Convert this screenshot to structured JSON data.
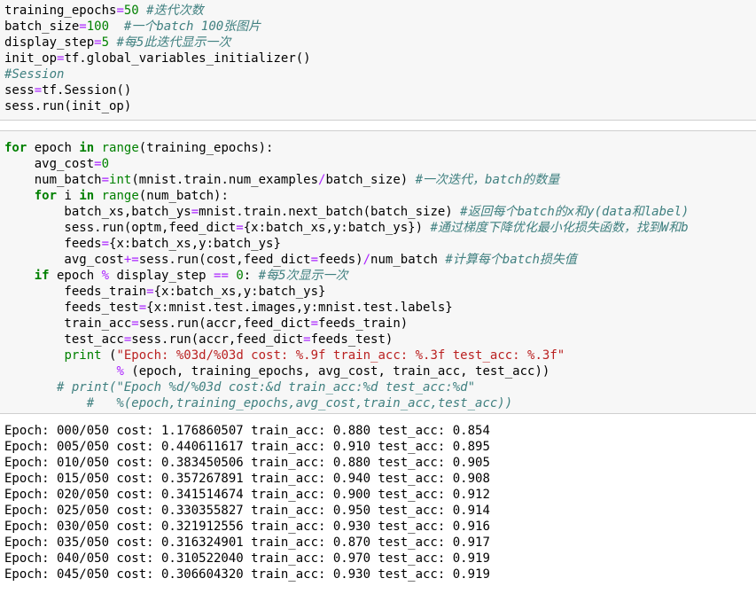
{
  "cells": {
    "top": {
      "lines": [
        [
          {
            "t": "pl",
            "v": "training_epochs"
          },
          {
            "t": "op",
            "v": "="
          },
          {
            "t": "nm",
            "v": "50"
          },
          {
            "t": "pl",
            "v": " "
          },
          {
            "t": "cm",
            "v": "#迭代次数"
          }
        ],
        [
          {
            "t": "pl",
            "v": "batch_size"
          },
          {
            "t": "op",
            "v": "="
          },
          {
            "t": "nm",
            "v": "100"
          },
          {
            "t": "pl",
            "v": "  "
          },
          {
            "t": "cm",
            "v": "#一个batch 100张图片"
          }
        ],
        [
          {
            "t": "pl",
            "v": "display_step"
          },
          {
            "t": "op",
            "v": "="
          },
          {
            "t": "nm",
            "v": "5"
          },
          {
            "t": "pl",
            "v": " "
          },
          {
            "t": "cm",
            "v": "#每5此迭代显示一次"
          }
        ],
        [
          {
            "t": "pl",
            "v": "init_op"
          },
          {
            "t": "op",
            "v": "="
          },
          {
            "t": "pl",
            "v": "tf.global_variables_initializer()"
          }
        ],
        [
          {
            "t": "cm",
            "v": "#Session"
          }
        ],
        [
          {
            "t": "pl",
            "v": "sess"
          },
          {
            "t": "op",
            "v": "="
          },
          {
            "t": "pl",
            "v": "tf.Session()"
          }
        ],
        [
          {
            "t": "pl",
            "v": "sess.run(init_op)"
          }
        ]
      ]
    },
    "main": {
      "lines": [
        [
          {
            "t": "kw",
            "v": "for"
          },
          {
            "t": "pl",
            "v": " epoch "
          },
          {
            "t": "kw",
            "v": "in"
          },
          {
            "t": "pl",
            "v": " "
          },
          {
            "t": "bi",
            "v": "range"
          },
          {
            "t": "pl",
            "v": "(training_epochs):"
          }
        ],
        [
          {
            "t": "pl",
            "v": "    avg_cost"
          },
          {
            "t": "op",
            "v": "="
          },
          {
            "t": "nm",
            "v": "0"
          }
        ],
        [
          {
            "t": "pl",
            "v": "    num_batch"
          },
          {
            "t": "op",
            "v": "="
          },
          {
            "t": "bi",
            "v": "int"
          },
          {
            "t": "pl",
            "v": "(mnist.train.num_examples"
          },
          {
            "t": "op",
            "v": "/"
          },
          {
            "t": "pl",
            "v": "batch_size) "
          },
          {
            "t": "cm",
            "v": "#一次迭代，batch的数量"
          }
        ],
        [
          {
            "t": "pl",
            "v": "    "
          },
          {
            "t": "kw",
            "v": "for"
          },
          {
            "t": "pl",
            "v": " i "
          },
          {
            "t": "kw",
            "v": "in"
          },
          {
            "t": "pl",
            "v": " "
          },
          {
            "t": "bi",
            "v": "range"
          },
          {
            "t": "pl",
            "v": "(num_batch):"
          }
        ],
        [
          {
            "t": "pl",
            "v": "        batch_xs,batch_ys"
          },
          {
            "t": "op",
            "v": "="
          },
          {
            "t": "pl",
            "v": "mnist.train.next_batch(batch_size) "
          },
          {
            "t": "cm",
            "v": "#返回每个batch的x和y(data和label)"
          }
        ],
        [
          {
            "t": "pl",
            "v": "        sess.run(optm,feed_dict"
          },
          {
            "t": "op",
            "v": "="
          },
          {
            "t": "pl",
            "v": "{x:batch_xs,y:batch_ys}) "
          },
          {
            "t": "cm",
            "v": "#通过梯度下降优化最小化损失函数，找到W和b"
          }
        ],
        [
          {
            "t": "pl",
            "v": "        feeds"
          },
          {
            "t": "op",
            "v": "="
          },
          {
            "t": "pl",
            "v": "{x:batch_xs,y:batch_ys}"
          }
        ],
        [
          {
            "t": "pl",
            "v": "        avg_cost"
          },
          {
            "t": "op",
            "v": "+="
          },
          {
            "t": "pl",
            "v": "sess.run(cost,feed_dict"
          },
          {
            "t": "op",
            "v": "="
          },
          {
            "t": "pl",
            "v": "feeds)"
          },
          {
            "t": "op",
            "v": "/"
          },
          {
            "t": "pl",
            "v": "num_batch "
          },
          {
            "t": "cm",
            "v": "#计算每个batch损失值"
          }
        ],
        [
          {
            "t": "pl",
            "v": "    "
          },
          {
            "t": "kw",
            "v": "if"
          },
          {
            "t": "pl",
            "v": " epoch "
          },
          {
            "t": "op",
            "v": "%"
          },
          {
            "t": "pl",
            "v": " display_step "
          },
          {
            "t": "op",
            "v": "=="
          },
          {
            "t": "pl",
            "v": " "
          },
          {
            "t": "nm",
            "v": "0"
          },
          {
            "t": "pl",
            "v": ": "
          },
          {
            "t": "cm",
            "v": "#每5次显示一次"
          }
        ],
        [
          {
            "t": "pl",
            "v": "        feeds_train"
          },
          {
            "t": "op",
            "v": "="
          },
          {
            "t": "pl",
            "v": "{x:batch_xs,y:batch_ys}"
          }
        ],
        [
          {
            "t": "pl",
            "v": "        feeds_test"
          },
          {
            "t": "op",
            "v": "="
          },
          {
            "t": "pl",
            "v": "{x:mnist.test.images,y:mnist.test.labels}"
          }
        ],
        [
          {
            "t": "pl",
            "v": "        train_acc"
          },
          {
            "t": "op",
            "v": "="
          },
          {
            "t": "pl",
            "v": "sess.run(accr,feed_dict"
          },
          {
            "t": "op",
            "v": "="
          },
          {
            "t": "pl",
            "v": "feeds_train)"
          }
        ],
        [
          {
            "t": "pl",
            "v": "        test_acc"
          },
          {
            "t": "op",
            "v": "="
          },
          {
            "t": "pl",
            "v": "sess.run(accr,feed_dict"
          },
          {
            "t": "op",
            "v": "="
          },
          {
            "t": "pl",
            "v": "feeds_test)"
          }
        ],
        [
          {
            "t": "pl",
            "v": "        "
          },
          {
            "t": "bi",
            "v": "print"
          },
          {
            "t": "pl",
            "v": " ("
          },
          {
            "t": "st",
            "v": "\"Epoch: %03d/%03d cost: %.9f train_acc: %.3f test_acc: %.3f\""
          }
        ],
        [
          {
            "t": "pl",
            "v": "               "
          },
          {
            "t": "op",
            "v": "%"
          },
          {
            "t": "pl",
            "v": " (epoch, training_epochs, avg_cost, train_acc, test_acc))"
          }
        ],
        [
          {
            "t": "pl",
            "v": "       "
          },
          {
            "t": "cm",
            "v": "# print(\"Epoch %d/%03d cost:&d train_acc:%d test_acc:%d\""
          }
        ],
        [
          {
            "t": "pl",
            "v": "           "
          },
          {
            "t": "cm",
            "v": "#   %(epoch,training_epochs,avg_cost,train_acc,test_acc))"
          }
        ]
      ]
    }
  },
  "output": {
    "lines": [
      "Epoch: 000/050 cost: 1.176860507 train_acc: 0.880 test_acc: 0.854",
      "Epoch: 005/050 cost: 0.440611617 train_acc: 0.910 test_acc: 0.895",
      "Epoch: 010/050 cost: 0.383450506 train_acc: 0.880 test_acc: 0.905",
      "Epoch: 015/050 cost: 0.357267891 train_acc: 0.940 test_acc: 0.908",
      "Epoch: 020/050 cost: 0.341514674 train_acc: 0.900 test_acc: 0.912",
      "Epoch: 025/050 cost: 0.330355827 train_acc: 0.950 test_acc: 0.914",
      "Epoch: 030/050 cost: 0.321912556 train_acc: 0.930 test_acc: 0.916",
      "Epoch: 035/050 cost: 0.316324901 train_acc: 0.870 test_acc: 0.917",
      "Epoch: 040/050 cost: 0.310522040 train_acc: 0.970 test_acc: 0.919",
      "Epoch: 045/050 cost: 0.306604320 train_acc: 0.930 test_acc: 0.919"
    ]
  }
}
